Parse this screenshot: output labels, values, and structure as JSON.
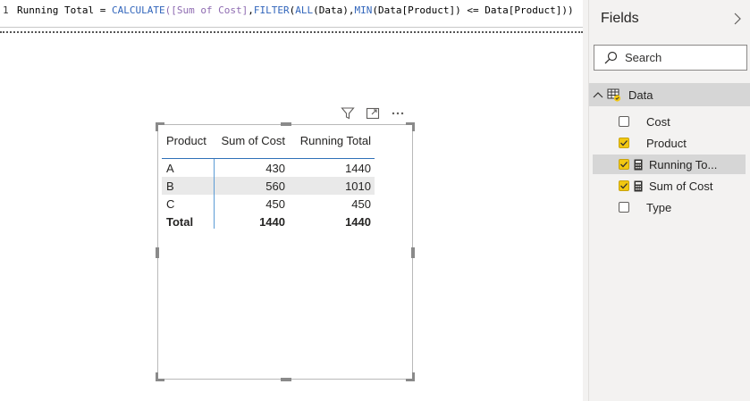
{
  "formula": {
    "line_number": "1",
    "tokens": [
      {
        "t": "Running Total = ",
        "k": "plain"
      },
      {
        "t": "CALCULATE",
        "k": "fn"
      },
      {
        "t": "([Sum of Cost]",
        "k": "meas"
      },
      {
        "t": ",",
        "k": "plain"
      },
      {
        "t": "FILTER",
        "k": "fn"
      },
      {
        "t": "(",
        "k": "plain"
      },
      {
        "t": "ALL",
        "k": "fn"
      },
      {
        "t": "(Data),",
        "k": "plain"
      },
      {
        "t": "MIN",
        "k": "fn"
      },
      {
        "t": "(Data[Product]) <= Data[Product]))",
        "k": "plain"
      }
    ]
  },
  "visual_header": {
    "icons": [
      "filter-icon",
      "focus-mode-icon",
      "more-options-icon"
    ]
  },
  "table": {
    "columns": [
      "Product",
      "Sum of Cost",
      "Running Total"
    ],
    "rows": [
      {
        "product": "A",
        "sum_of_cost": "430",
        "running_total": "1440"
      },
      {
        "product": "B",
        "sum_of_cost": "560",
        "running_total": "1010"
      },
      {
        "product": "C",
        "sum_of_cost": "450",
        "running_total": "450"
      }
    ],
    "total": {
      "label": "Total",
      "sum_of_cost": "1440",
      "running_total": "1440"
    }
  },
  "fields_pane": {
    "title": "Fields",
    "search_placeholder": "Search",
    "table_name": "Data",
    "fields": [
      {
        "label": "Cost",
        "checked": false,
        "icon": "",
        "selected": false
      },
      {
        "label": "Product",
        "checked": true,
        "icon": "",
        "selected": false
      },
      {
        "label": "Running To...",
        "checked": true,
        "icon": "calculator-icon",
        "selected": true
      },
      {
        "label": "Sum of Cost",
        "checked": true,
        "icon": "calculator-icon",
        "selected": false
      },
      {
        "label": "Type",
        "checked": false,
        "icon": "",
        "selected": false
      }
    ]
  },
  "colors": {
    "accent": "#f2c811",
    "function": "#3165bb",
    "measure": "#8e6bb1",
    "header_separator": "#2f70b8"
  }
}
